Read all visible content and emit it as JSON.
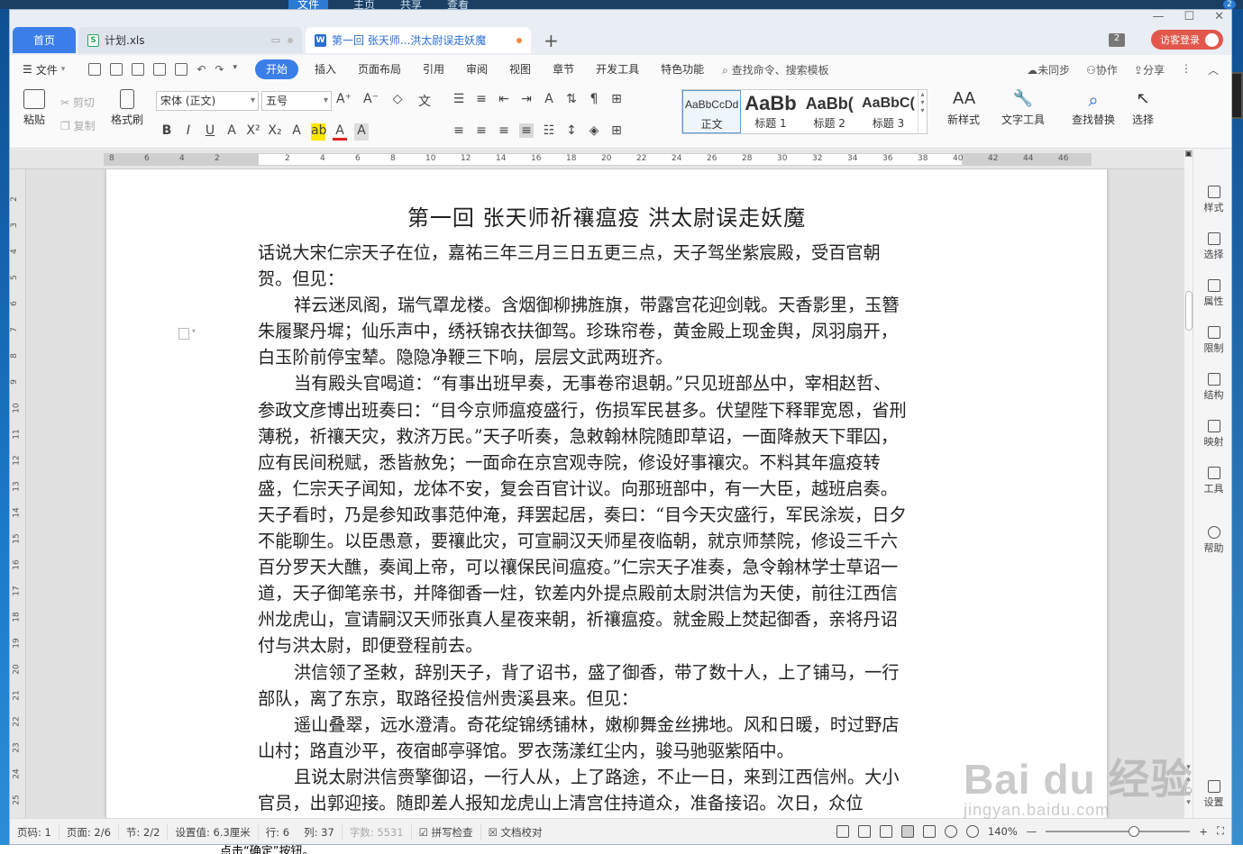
{
  "desktop": {
    "top_menu": [
      "文件",
      "主页",
      "共享",
      "查看"
    ],
    "badge": "2",
    "bottom_text": "点击“确定”按钮。"
  },
  "tabs": {
    "home": "首页",
    "xls": "计划.xls",
    "doc": "第一回 张天师...洪太尉误走妖魔",
    "add": "+"
  },
  "window": {
    "doc_count": "2",
    "login": "访客登录"
  },
  "menu": {
    "file": "文件",
    "items": [
      "开始",
      "插入",
      "页面布局",
      "引用",
      "审阅",
      "视图",
      "章节",
      "开发工具",
      "特色功能"
    ],
    "search": "查找命令、搜索模板",
    "right": [
      "未同步",
      "协作",
      "分享"
    ]
  },
  "ribbon": {
    "paste": "粘贴",
    "cut": "剪切",
    "copy": "复制",
    "format_painter": "格式刷",
    "font_name": "宋体 (正文)",
    "font_size": "五号",
    "styles": [
      {
        "sample": "AaBbCcDd",
        "label": "正文"
      },
      {
        "sample": "AaBb",
        "label": "标题 1"
      },
      {
        "sample": "AaBb(",
        "label": "标题 2"
      },
      {
        "sample": "AaBbC(",
        "label": "标题 3"
      }
    ],
    "new_style": "新样式",
    "text_tools": "文字工具",
    "find_replace": "查找替换",
    "select": "选择"
  },
  "ruler": {
    "h_ticks": [
      "8",
      "6",
      "4",
      "2",
      "",
      "2",
      "4",
      "6",
      "8",
      "10",
      "12",
      "14",
      "16",
      "18",
      "20",
      "22",
      "24",
      "26",
      "28",
      "30",
      "32",
      "34",
      "36",
      "38",
      "40",
      "42",
      "44",
      "46"
    ],
    "v_ticks": [
      "2",
      "3",
      "4",
      "5",
      "6",
      "7",
      "8",
      "9",
      "10",
      "11",
      "12",
      "13",
      "14",
      "15",
      "16",
      "17",
      "18",
      "19",
      "20",
      "21",
      "22",
      "23",
      "24",
      "25"
    ]
  },
  "document": {
    "title": "第一回  张天师祈禳瘟疫    洪太尉误走妖魔",
    "paragraphs": [
      {
        "indent": false,
        "text": "话说大宋仁宗天子在位，嘉祐三年三月三日五更三点，天子驾坐紫宸殿，受百官朝贺。但见："
      },
      {
        "indent": true,
        "text": "祥云迷凤阁，瑞气罩龙楼。含烟御柳拂旌旗，带露宫花迎剑戟。天香影里，玉簪朱履聚丹墀；仙乐声中，绣袄锦衣扶御驾。珍珠帘卷，黄金殿上现金舆，凤羽扇开，白玉阶前停宝辇。隐隐净鞭三下响，层层文武两班齐。"
      },
      {
        "indent": true,
        "text": "当有殿头官喝道：“有事出班早奏，无事卷帘退朝。”只见班部丛中，宰相赵哲、参政文彦博出班奏曰：“目今京师瘟疫盛行，伤损军民甚多。伏望陛下释罪宽恩，省刑薄税，祈禳天灾，救济万民。”天子听奏，急敕翰林院随即草诏，一面降赦天下罪囚，应有民间税赋，悉皆赦免；一面命在京宫观寺院，修设好事禳灾。不料其年瘟疫转盛，仁宗天子闻知，龙体不安，复会百官计议。向那班部中，有一大臣，越班启奏。天子看时，乃是参知政事范仲淹，拜罢起居，奏曰：“目今天灾盛行，军民涂炭，日夕不能聊生。以臣愚意，要禳此灾，可宣嗣汉天师星夜临朝，就京师禁院，修设三千六百分罗天大醮，奏闻上帝，可以禳保民间瘟疫。”仁宗天子准奏，急令翰林学士草诏一道，天子御笔亲书，并降御香一炷，钦差内外提点殿前太尉洪信为天使，前往江西信州龙虎山，宣请嗣汉天师张真人星夜来朝，祈禳瘟疫。就金殿上焚起御香，亲将丹诏付与洪太尉，即便登程前去。"
      },
      {
        "indent": true,
        "text": "洪信领了圣敕，辞别天子，背了诏书，盛了御香，带了数十人，上了铺马，一行部队，离了东京，取路径投信州贵溪县来。但见："
      },
      {
        "indent": true,
        "text": "遥山叠翠，远水澄清。奇花绽锦绣铺林，嫩柳舞金丝拂地。风和日暖，时过野店山村；路直沙平，夜宿邮亭驿馆。罗衣荡漾红尘内，骏马驰驱紫陌中。"
      },
      {
        "indent": true,
        "text": "且说太尉洪信赍擎御诏，一行人从，上了路途，不止一日，来到江西信州。大小官员，出郭迎接。随即差人报知龙虎山上清宫住持道众，准备接诏。次日，众位"
      }
    ]
  },
  "sidebar": {
    "items": [
      "样式",
      "选择",
      "属性",
      "限制",
      "结构",
      "映射",
      "工具",
      "帮助",
      "设置"
    ]
  },
  "status": {
    "page_no": "页码: 1",
    "pages": "页面: 2/6",
    "section": "节: 2/2",
    "setting": "设置值: 6.3厘米",
    "row": "行: 6",
    "col": "列: 37",
    "words": "字数: 5531",
    "spell": "拼写检查",
    "proof": "文档校对",
    "zoom": "140%"
  },
  "watermark": {
    "main": "Bai du 经验",
    "sub": "jingyan.baidu.com"
  }
}
